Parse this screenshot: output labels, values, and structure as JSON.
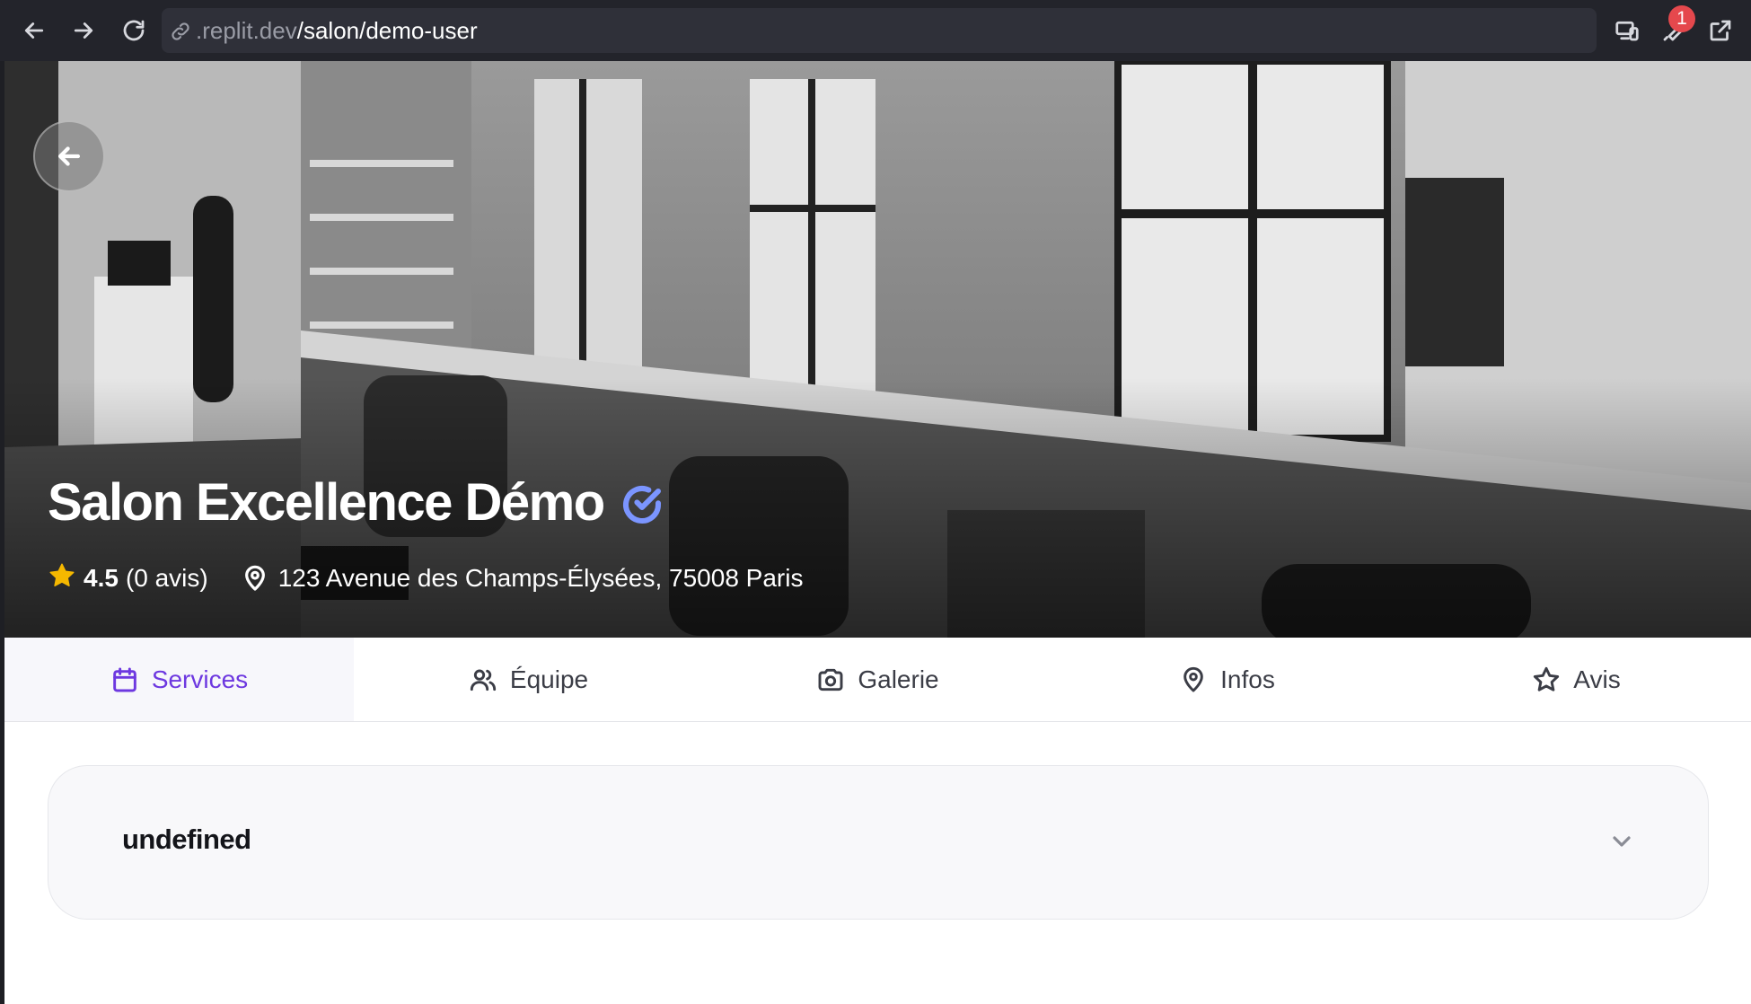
{
  "browser": {
    "url_host": ".replit.dev",
    "url_path": "/salon/demo-user",
    "notification_count": "1"
  },
  "salon": {
    "name": "Salon Excellence Démo",
    "rating": "4.5",
    "reviews": "(0 avis)",
    "address": "123 Avenue des Champs-Élysées, 75008 Paris"
  },
  "tabs": [
    {
      "label": "Services",
      "icon": "calendar-icon",
      "active": true
    },
    {
      "label": "Équipe",
      "icon": "users-icon",
      "active": false
    },
    {
      "label": "Galerie",
      "icon": "camera-icon",
      "active": false
    },
    {
      "label": "Infos",
      "icon": "map-pin-icon",
      "active": false
    },
    {
      "label": "Avis",
      "icon": "star-icon",
      "active": false
    }
  ],
  "section": {
    "title": "undefined"
  },
  "colors": {
    "accent": "#6d38e0",
    "verified": "#7b95ff",
    "star": "#f5b800",
    "badge": "#e5484d"
  }
}
